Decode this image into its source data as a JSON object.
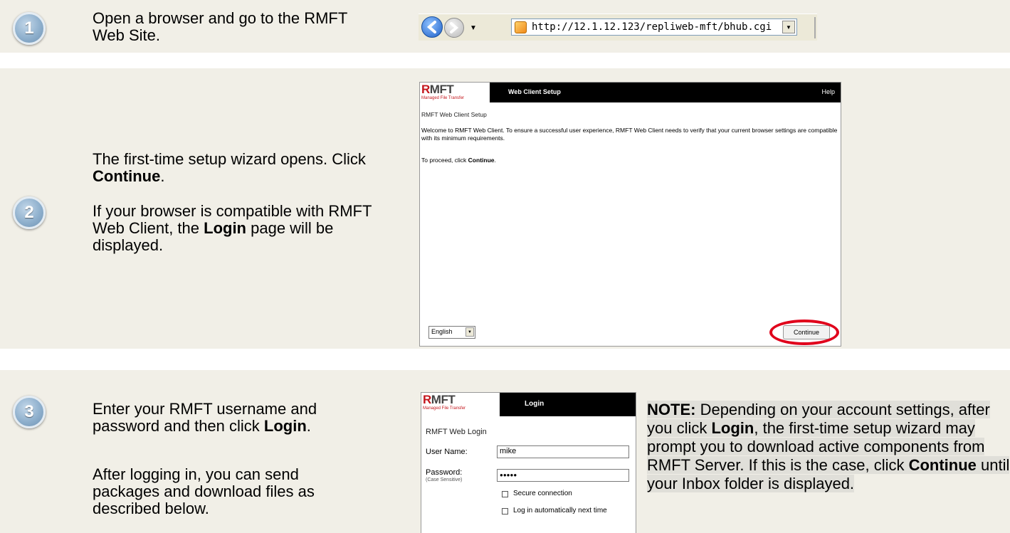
{
  "steps": [
    {
      "number": "1",
      "text": "Open a browser and go to the RMFT Web Site."
    },
    {
      "number": "2",
      "text_a": "The first-time setup wizard opens. Click ",
      "text_a_bold": "Continue",
      "text_a_end": ".",
      "text_b": "If your browser is compatible with RMFT Web Client, the ",
      "text_b_bold": "Login",
      "text_b_end": " page will be displayed."
    },
    {
      "number": "3",
      "text_a": "Enter your RMFT username and password and then click ",
      "text_a_bold": "Login",
      "text_a_end": ".",
      "text_b": "After logging in, you can send packages and download files as described below."
    }
  ],
  "browser": {
    "url": "http://12.1.12.123/repliweb-mft/bhub.cgi"
  },
  "setup_window": {
    "logo_r": "R",
    "logo_rest": "MFT",
    "logo_sub": "Managed File Transfer",
    "tab": "Web Client Setup",
    "help": "Help",
    "heading": "RMFT Web Client Setup",
    "welcome": "Welcome to RMFT Web Client. To ensure a successful user experience, RMFT Web Client needs to verify that your current browser settings are compatible with its minimum requirements.",
    "proceed_prefix": "To proceed, click ",
    "proceed_bold": "Continue",
    "proceed_end": ".",
    "language": "English",
    "continue_button": "Continue"
  },
  "login_window": {
    "logo_r": "R",
    "logo_rest": "MFT",
    "logo_sub": "Managed File Transfer",
    "tab": "Login",
    "heading": "RMFT Web Login",
    "username_label": "User Name:",
    "username_value": "mike",
    "password_label": "Password:",
    "password_hint": "(Case Sensitive)",
    "password_value": "●●●●●",
    "secure_label": "Secure connection",
    "auto_label": "Log in automatically next time"
  },
  "note": {
    "bold": "NOTE:",
    "t1": " Depending on your account settings, after you click ",
    "b1": "Login",
    "t2": ", the first-time setup wizard may prompt you to download active components from RMFT Server. If this is the case, click ",
    "b2": "Continue",
    "t3": " until your Inbox folder is displayed."
  },
  "colors": {
    "band": "#f1efe7",
    "highlight": "#e0001b",
    "note_bg": "#e0dfd9"
  },
  "icons": [
    "back-arrow-icon",
    "forward-arrow-icon",
    "dropdown-arrow-icon",
    "page-icon"
  ]
}
